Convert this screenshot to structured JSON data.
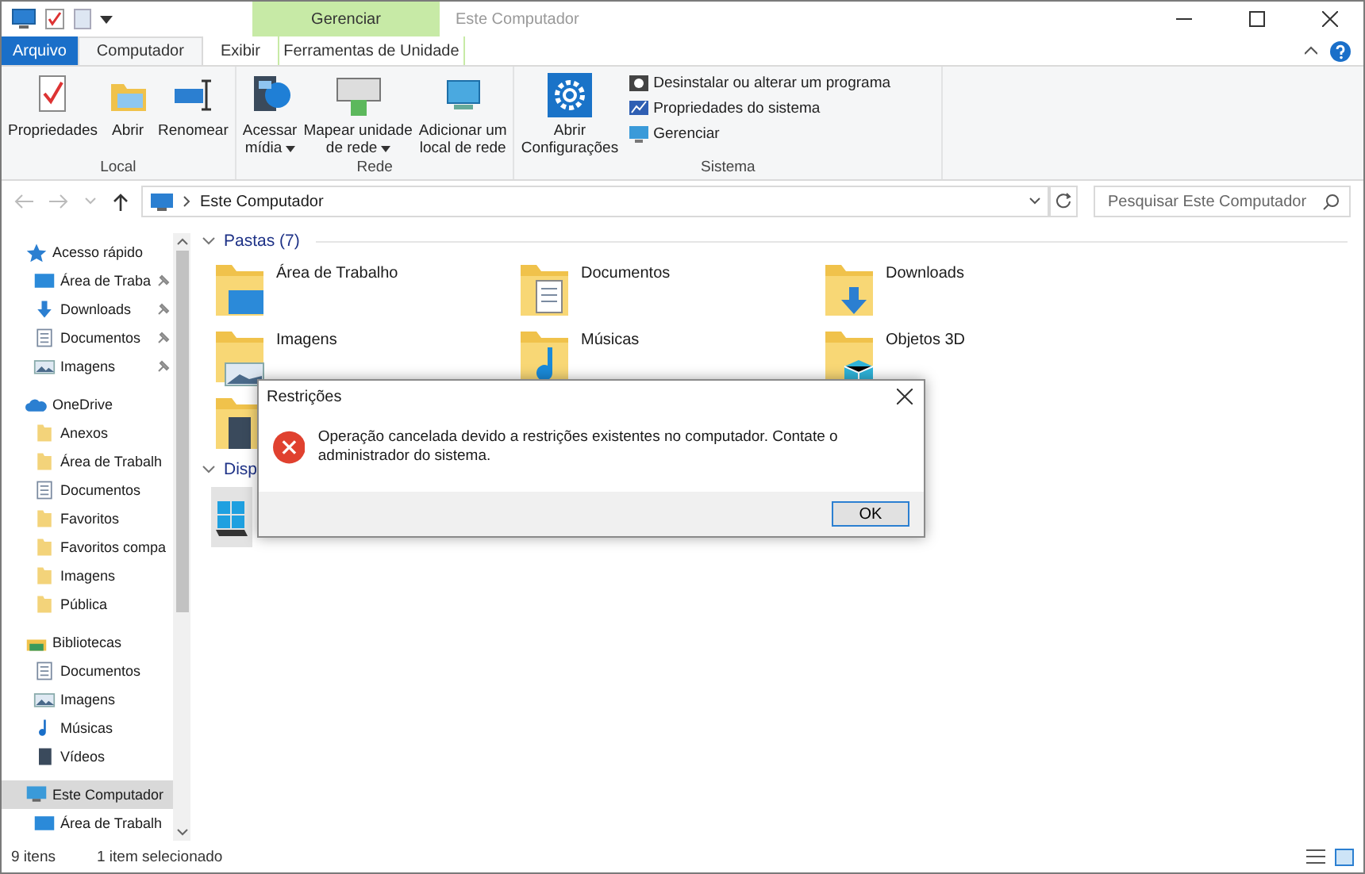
{
  "window": {
    "title": "Este Computador",
    "context_group": "Gerenciar"
  },
  "tabs": [
    {
      "label": "Arquivo",
      "kind": "file",
      "selected": false
    },
    {
      "label": "Computador",
      "kind": "normal",
      "selected": true
    },
    {
      "label": "Exibir",
      "kind": "normal",
      "selected": false
    },
    {
      "label": "Ferramentas de Unidade",
      "kind": "contextual",
      "selected": false
    }
  ],
  "ribbon": [
    {
      "name": "Local",
      "large": [
        {
          "lines": [
            "Propriedades"
          ],
          "kind": "properties",
          "dropdown": false
        },
        {
          "lines": [
            "Abrir"
          ],
          "kind": "open",
          "dropdown": false
        },
        {
          "lines": [
            "Renomear"
          ],
          "kind": "rename",
          "dropdown": false
        }
      ]
    },
    {
      "name": "Rede",
      "large": [
        {
          "lines": [
            "Acessar",
            "mídia"
          ],
          "kind": "media",
          "dropdown": true
        },
        {
          "lines": [
            "Mapear unidade",
            "de rede"
          ],
          "kind": "drive",
          "dropdown": true
        },
        {
          "lines": [
            "Adicionar um",
            "local de rede"
          ],
          "kind": "network",
          "dropdown": false
        }
      ]
    },
    {
      "name": "Sistema",
      "large": [
        {
          "lines": [
            "Abrir",
            "Configurações"
          ],
          "kind": "settings",
          "dropdown": false
        }
      ],
      "small": [
        {
          "label": "Desinstalar ou alterar um programa",
          "kind": "uninstall"
        },
        {
          "label": "Propriedades do sistema",
          "kind": "sysprops"
        },
        {
          "label": "Gerenciar",
          "kind": "manage"
        }
      ]
    }
  ],
  "address": {
    "path": "Este Computador",
    "search_placeholder": "Pesquisar Este Computador"
  },
  "nav": [
    {
      "label": "Acesso rápido",
      "kind": "star",
      "selected": false,
      "children": [
        {
          "label": "Área de Traba",
          "kind": "desktop",
          "pinned": true
        },
        {
          "label": "Downloads",
          "kind": "download",
          "pinned": true
        },
        {
          "label": "Documentos",
          "kind": "document",
          "pinned": true
        },
        {
          "label": "Imagens",
          "kind": "image",
          "pinned": true
        }
      ]
    },
    {
      "label": "OneDrive",
      "kind": "cloud",
      "selected": false,
      "children": [
        {
          "label": "Anexos",
          "kind": "folder",
          "pinned": false
        },
        {
          "label": "Área de Trabalh",
          "kind": "folder",
          "pinned": false
        },
        {
          "label": "Documentos",
          "kind": "document",
          "pinned": false
        },
        {
          "label": "Favoritos",
          "kind": "folder",
          "pinned": false
        },
        {
          "label": "Favoritos compa",
          "kind": "folder",
          "pinned": false
        },
        {
          "label": "Imagens",
          "kind": "folder",
          "pinned": false
        },
        {
          "label": "Pública",
          "kind": "folder",
          "pinned": false
        }
      ]
    },
    {
      "label": "Bibliotecas",
      "kind": "library",
      "selected": false,
      "children": [
        {
          "label": "Documentos",
          "kind": "document",
          "pinned": false
        },
        {
          "label": "Imagens",
          "kind": "image",
          "pinned": false
        },
        {
          "label": "Músicas",
          "kind": "music",
          "pinned": false
        },
        {
          "label": "Vídeos",
          "kind": "video",
          "pinned": false
        }
      ]
    },
    {
      "label": "Este Computador",
      "kind": "pc",
      "selected": true,
      "children": [
        {
          "label": "Área de Trabalh",
          "kind": "desktop",
          "pinned": false
        }
      ]
    }
  ],
  "folders_group": {
    "heading": "Pastas (7)",
    "items": [
      {
        "label": "Área de Trabalho",
        "kind": "desktop"
      },
      {
        "label": "Documentos",
        "kind": "document"
      },
      {
        "label": "Downloads",
        "kind": "download"
      },
      {
        "label": "Imagens",
        "kind": "image"
      },
      {
        "label": "Músicas",
        "kind": "music"
      },
      {
        "label": "Objetos 3D",
        "kind": "cube"
      },
      {
        "kind": "video"
      }
    ]
  },
  "devices_group": {
    "heading": "Disp"
  },
  "status_bar": {
    "count": "9 itens",
    "selection": "1 item selecionado"
  },
  "dialog": {
    "title": "Restrições",
    "message": "Operação cancelada devido a restrições existentes no computador. Contate o administrador do sistema.",
    "button": "OK"
  }
}
